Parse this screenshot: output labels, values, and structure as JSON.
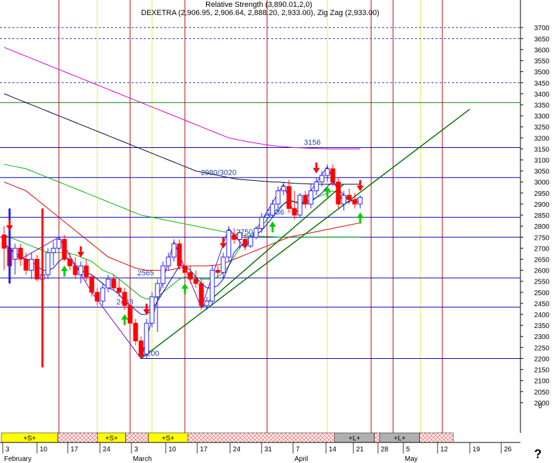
{
  "header": {
    "line1": "Relative Strength (3,890.01,2,0)",
    "line2": "DEXETRA (2,906.95, 2,906.64, 2,888.20, 2,933.00), Zig Zag (2,933.00)"
  },
  "help_label": "?",
  "colors": {
    "up": "#1a1aff",
    "down": "#ff0000",
    "ma_fast": "#0000cc",
    "ma_mid": "#00b000",
    "ma_slow": "#d40000",
    "ma_long": "#000040",
    "ma_xlong": "#cc00cc",
    "trend": "#007000",
    "zigzag": "#6a0dad",
    "level": "#0000b0",
    "buy_arrow": "#00cc00",
    "sell_arrow": "#ff0000",
    "strip_yellow": "#ffff00",
    "strip_gray": "#b0b0b0",
    "strip_hatch": "#ff8080"
  },
  "chart_data": {
    "type": "candlestick",
    "title": "DEXETRA",
    "ylim": [
      1950,
      3800
    ],
    "y_ticks": [
      2000,
      2050,
      2100,
      2150,
      2200,
      2250,
      2300,
      2350,
      2400,
      2450,
      2500,
      2550,
      2600,
      2650,
      2700,
      2750,
      2800,
      2850,
      2900,
      2950,
      3000,
      3050,
      3100,
      3150,
      3200,
      3250,
      3300,
      3350,
      3400,
      3450,
      3500,
      3550,
      3600,
      3650,
      3700
    ],
    "zero_label": "0",
    "x_labels": [
      "3",
      "10",
      "17",
      "24",
      "3",
      "10",
      "17",
      "24",
      "31",
      "7",
      "14",
      "21",
      "28",
      "5",
      "12",
      "19",
      "26"
    ],
    "month_labels": [
      {
        "label": "February",
        "index": 0
      },
      {
        "label": "March",
        "index": 4
      },
      {
        "label": "April",
        "index": 9
      },
      {
        "label": "May",
        "index": 13
      }
    ],
    "candles": [
      {
        "o": 2760,
        "h": 2800,
        "l": 2600,
        "c": 2700
      },
      {
        "o": 2700,
        "h": 2760,
        "l": 2600,
        "c": 2620
      },
      {
        "o": 2650,
        "h": 2720,
        "l": 2580,
        "c": 2700
      },
      {
        "o": 2700,
        "h": 2720,
        "l": 2620,
        "c": 2650
      },
      {
        "o": 2650,
        "h": 2680,
        "l": 2580,
        "c": 2600
      },
      {
        "o": 2600,
        "h": 2680,
        "l": 2560,
        "c": 2650
      },
      {
        "o": 2650,
        "h": 2670,
        "l": 2550,
        "c": 2560
      },
      {
        "o": 2560,
        "h": 2600,
        "l": 2520,
        "c": 2580
      },
      {
        "o": 2580,
        "h": 2700,
        "l": 2560,
        "c": 2680
      },
      {
        "o": 2680,
        "h": 2730,
        "l": 2620,
        "c": 2700
      },
      {
        "o": 2700,
        "h": 2760,
        "l": 2680,
        "c": 2740
      },
      {
        "o": 2740,
        "h": 2760,
        "l": 2640,
        "c": 2650
      },
      {
        "o": 2650,
        "h": 2680,
        "l": 2600,
        "c": 2620
      },
      {
        "o": 2620,
        "h": 2660,
        "l": 2560,
        "c": 2580
      },
      {
        "o": 2580,
        "h": 2640,
        "l": 2540,
        "c": 2620
      },
      {
        "o": 2620,
        "h": 2650,
        "l": 2550,
        "c": 2570
      },
      {
        "o": 2570,
        "h": 2580,
        "l": 2480,
        "c": 2500
      },
      {
        "o": 2500,
        "h": 2520,
        "l": 2440,
        "c": 2460
      },
      {
        "o": 2460,
        "h": 2540,
        "l": 2440,
        "c": 2520
      },
      {
        "o": 2520,
        "h": 2580,
        "l": 2500,
        "c": 2560
      },
      {
        "o": 2560,
        "h": 2580,
        "l": 2510,
        "c": 2520
      },
      {
        "o": 2520,
        "h": 2560,
        "l": 2480,
        "c": 2500
      },
      {
        "o": 2500,
        "h": 2520,
        "l": 2420,
        "c": 2440
      },
      {
        "o": 2440,
        "h": 2460,
        "l": 2340,
        "c": 2360
      },
      {
        "o": 2360,
        "h": 2380,
        "l": 2260,
        "c": 2280
      },
      {
        "o": 2280,
        "h": 2300,
        "l": 2200,
        "c": 2210
      },
      {
        "o": 2220,
        "h": 2380,
        "l": 2200,
        "c": 2360
      },
      {
        "o": 2360,
        "h": 2500,
        "l": 2340,
        "c": 2480
      },
      {
        "o": 2480,
        "h": 2560,
        "l": 2320,
        "c": 2540
      },
      {
        "o": 2540,
        "h": 2640,
        "l": 2520,
        "c": 2620
      },
      {
        "o": 2620,
        "h": 2680,
        "l": 2600,
        "c": 2660
      },
      {
        "o": 2660,
        "h": 2740,
        "l": 2640,
        "c": 2720
      },
      {
        "o": 2720,
        "h": 2740,
        "l": 2600,
        "c": 2620
      },
      {
        "o": 2620,
        "h": 2660,
        "l": 2560,
        "c": 2590
      },
      {
        "o": 2590,
        "h": 2620,
        "l": 2540,
        "c": 2560
      },
      {
        "o": 2560,
        "h": 2600,
        "l": 2520,
        "c": 2540
      },
      {
        "o": 2540,
        "h": 2560,
        "l": 2420,
        "c": 2440
      },
      {
        "o": 2440,
        "h": 2480,
        "l": 2420,
        "c": 2460
      },
      {
        "o": 2460,
        "h": 2620,
        "l": 2440,
        "c": 2600
      },
      {
        "o": 2600,
        "h": 2620,
        "l": 2570,
        "c": 2590
      },
      {
        "o": 2590,
        "h": 2680,
        "l": 2560,
        "c": 2660
      },
      {
        "o": 2660,
        "h": 2800,
        "l": 2640,
        "c": 2780
      },
      {
        "o": 2760,
        "h": 2790,
        "l": 2720,
        "c": 2740
      },
      {
        "o": 2740,
        "h": 2780,
        "l": 2700,
        "c": 2770
      },
      {
        "o": 2740,
        "h": 2760,
        "l": 2690,
        "c": 2710
      },
      {
        "o": 2710,
        "h": 2760,
        "l": 2700,
        "c": 2750
      },
      {
        "o": 2750,
        "h": 2800,
        "l": 2740,
        "c": 2790
      },
      {
        "o": 2790,
        "h": 2860,
        "l": 2770,
        "c": 2840
      },
      {
        "o": 2840,
        "h": 2880,
        "l": 2820,
        "c": 2850
      },
      {
        "o": 2850,
        "h": 2920,
        "l": 2840,
        "c": 2900
      },
      {
        "o": 2900,
        "h": 2980,
        "l": 2880,
        "c": 2960
      },
      {
        "o": 2960,
        "h": 3000,
        "l": 2940,
        "c": 2980
      },
      {
        "o": 2980,
        "h": 3010,
        "l": 2860,
        "c": 2880
      },
      {
        "o": 2880,
        "h": 2960,
        "l": 2830,
        "c": 2850
      },
      {
        "o": 2850,
        "h": 2950,
        "l": 2840,
        "c": 2940
      },
      {
        "o": 2940,
        "h": 2960,
        "l": 2880,
        "c": 2900
      },
      {
        "o": 2900,
        "h": 2990,
        "l": 2880,
        "c": 2960
      },
      {
        "o": 2960,
        "h": 3020,
        "l": 2940,
        "c": 3000
      },
      {
        "o": 3000,
        "h": 3050,
        "l": 2980,
        "c": 3030
      },
      {
        "o": 3030,
        "h": 3080,
        "l": 3000,
        "c": 3060
      },
      {
        "o": 3060,
        "h": 3080,
        "l": 2980,
        "c": 3000
      },
      {
        "o": 3000,
        "h": 3020,
        "l": 2880,
        "c": 2900
      },
      {
        "o": 2900,
        "h": 2960,
        "l": 2870,
        "c": 2940
      },
      {
        "o": 2940,
        "h": 2970,
        "l": 2900,
        "c": 2920
      },
      {
        "o": 2920,
        "h": 2950,
        "l": 2880,
        "c": 2900
      },
      {
        "o": 2900,
        "h": 2940,
        "l": 2880,
        "c": 2930
      }
    ],
    "levels": [
      {
        "value": 3156,
        "label": "3156",
        "label_at": 0.6
      },
      {
        "value": 3020,
        "label": "2980/3020",
        "label_at": 0.42
      },
      {
        "value": 2840,
        "label": "2836",
        "label_at": 0.53
      },
      {
        "value": 2750,
        "label": "2750",
        "label_at": 0.47
      },
      {
        "value": 2565,
        "label": "2565",
        "label_at": 0.28
      },
      {
        "value": 2433,
        "label": "2433",
        "label_at": 0.24
      },
      {
        "value": 2200,
        "label": "2200",
        "label_at": 0.29
      }
    ],
    "dashed_levels": [
      3650,
      3450,
      3700
    ],
    "solid_green_level": 3360,
    "vertical_lines": {
      "red": [
        10,
        23,
        33,
        48,
        67,
        71,
        80
      ],
      "yellow": [
        17,
        27,
        59,
        76
      ]
    },
    "signals": {
      "sell": [
        1,
        14,
        26,
        40,
        57,
        66,
        77
      ],
      "buy": [
        11,
        22,
        33,
        49,
        59,
        72,
        82
      ]
    },
    "ma_fast": [
      2720,
      2700,
      2680,
      2660,
      2650,
      2640,
      2620,
      2600,
      2600,
      2610,
      2640,
      2660,
      2650,
      2620,
      2600,
      2590,
      2580,
      2560,
      2540,
      2520,
      2510,
      2490,
      2460,
      2440,
      2420,
      2400,
      2400,
      2420,
      2460,
      2500,
      2540,
      2580,
      2620,
      2620,
      2600,
      2570,
      2540,
      2520,
      2520,
      2530,
      2560,
      2620,
      2680,
      2710,
      2720,
      2740,
      2760,
      2780,
      2810,
      2840,
      2870,
      2900,
      2920,
      2910,
      2900,
      2900,
      2910,
      2930,
      2950,
      2980,
      3000,
      2970,
      2940,
      2920,
      2910,
      2910
    ],
    "ma_mid": [
      2760,
      2750,
      2740,
      2730,
      2720,
      2710,
      2700,
      2690,
      2680,
      2680,
      2680,
      2680,
      2675,
      2670,
      2660,
      2650,
      2640,
      2620,
      2600,
      2590,
      2580,
      2560,
      2540,
      2520,
      2500,
      2480,
      2470,
      2470,
      2480,
      2500,
      2520,
      2540,
      2560,
      2570,
      2570,
      2570,
      2560,
      2560,
      2560,
      2570,
      2590,
      2620,
      2660,
      2700,
      2730,
      2760,
      2780,
      2800,
      2830,
      2860,
      2880,
      2900,
      2910,
      2910,
      2910,
      2910,
      2920,
      2930,
      2940,
      2950,
      2960,
      2950,
      2930,
      2920,
      2910,
      2910
    ],
    "ma_slow": [
      3000,
      2990,
      2980,
      2970,
      2960,
      2940,
      2920,
      2900,
      2880,
      2860,
      2840,
      2820,
      2800,
      2780,
      2760,
      2740,
      2720,
      2700,
      2680,
      2660,
      2650,
      2640,
      2630,
      2620,
      2610,
      2605,
      2600,
      2600,
      2600,
      2600,
      2600,
      2605,
      2610,
      2615,
      2620,
      2620,
      2620,
      2620,
      2622,
      2624,
      2630,
      2640,
      2650,
      2660,
      2670,
      2680,
      2690,
      2700,
      2710,
      2720,
      2730,
      2740,
      2750,
      2755,
      2760,
      2765,
      2770,
      2775,
      2780,
      2785,
      2790,
      2795,
      2800,
      2805,
      2810,
      2815
    ],
    "ma_green_slow": [
      3080,
      3075,
      3070,
      3065,
      3060,
      3050,
      3040,
      3030,
      3020,
      3010,
      3000,
      2990,
      2980,
      2970,
      2960,
      2950,
      2940,
      2930,
      2920,
      2910,
      2900,
      2890,
      2880,
      2870,
      2860,
      2850,
      2845,
      2840,
      2835,
      2830,
      2825,
      2820,
      2815,
      2810,
      2805,
      2800,
      2795,
      2790,
      2785,
      2780,
      2775,
      2770,
      2765,
      2760,
      2758,
      2756,
      2755,
      2754,
      2753,
      2752,
      2751,
      2750,
      2750,
      2750,
      2750,
      2750,
      2750,
      2750,
      2750,
      2750,
      2750,
      2750,
      2750,
      2750,
      2750,
      2750
    ],
    "ma_long": [
      3400,
      3390,
      3380,
      3370,
      3360,
      3350,
      3340,
      3330,
      3320,
      3310,
      3300,
      3290,
      3280,
      3270,
      3260,
      3250,
      3240,
      3230,
      3220,
      3210,
      3200,
      3190,
      3180,
      3170,
      3160,
      3150,
      3140,
      3130,
      3120,
      3110,
      3100,
      3090,
      3080,
      3070,
      3060,
      3050,
      3045,
      3040,
      3035,
      3030,
      3025,
      3020,
      3015,
      3012,
      3010,
      3008,
      3006,
      3004,
      3002,
      3000,
      3000,
      2998,
      2996,
      2994,
      2993,
      2992,
      2991,
      2990,
      2990,
      2990,
      2990,
      2990,
      2990,
      2990,
      2990,
      2990
    ],
    "ma_xlong": [
      3610,
      3600,
      3590,
      3580,
      3570,
      3560,
      3550,
      3540,
      3530,
      3520,
      3510,
      3500,
      3490,
      3480,
      3470,
      3460,
      3450,
      3440,
      3430,
      3420,
      3410,
      3400,
      3390,
      3380,
      3370,
      3360,
      3350,
      3340,
      3330,
      3320,
      3310,
      3300,
      3290,
      3280,
      3270,
      3260,
      3250,
      3240,
      3230,
      3220,
      3210,
      3200,
      3195,
      3190,
      3185,
      3180,
      3176,
      3172,
      3168,
      3165,
      3162,
      3160,
      3158,
      3156,
      3155,
      3154,
      3153,
      3152,
      3151,
      3150,
      3150,
      3150,
      3150,
      3150,
      3150,
      3150
    ],
    "trendline": [
      {
        "i": 25,
        "v": 2200
      },
      {
        "i": 85,
        "v": 3330
      }
    ],
    "trend2": [
      {
        "i": 36,
        "v": 2430
      },
      {
        "i": 62,
        "v": 2990
      }
    ],
    "zigzag": [
      [
        0,
        2720
      ],
      [
        3,
        2650
      ],
      [
        10,
        2750
      ],
      [
        16,
        2500
      ],
      [
        25,
        2200
      ],
      [
        31,
        2730
      ],
      [
        36,
        2430
      ],
      [
        41,
        2790
      ],
      [
        44,
        2700
      ],
      [
        51,
        2990
      ],
      [
        53,
        2850
      ],
      [
        59,
        3070
      ],
      [
        62,
        2900
      ],
      [
        65,
        2930
      ]
    ],
    "bottom_strip": [
      {
        "type": "yellow",
        "label": "+S+",
        "from": 0,
        "to": 10
      },
      {
        "type": "hatch",
        "label": "",
        "from": 10,
        "to": 17
      },
      {
        "type": "yellow",
        "label": "+S+",
        "from": 17,
        "to": 22
      },
      {
        "type": "hatch",
        "label": "",
        "from": 22,
        "to": 26
      },
      {
        "type": "yellow",
        "label": "+S+",
        "from": 26,
        "to": 33
      },
      {
        "type": "hatch",
        "label": "",
        "from": 33,
        "to": 59
      },
      {
        "type": "gray",
        "label": "+L+",
        "from": 59,
        "to": 66
      },
      {
        "type": "hatch",
        "label": "",
        "from": 66,
        "to": 67
      },
      {
        "type": "gray",
        "label": "+L+",
        "from": 67,
        "to": 74
      },
      {
        "type": "hatch",
        "label": "",
        "from": 74,
        "to": 80
      }
    ]
  }
}
